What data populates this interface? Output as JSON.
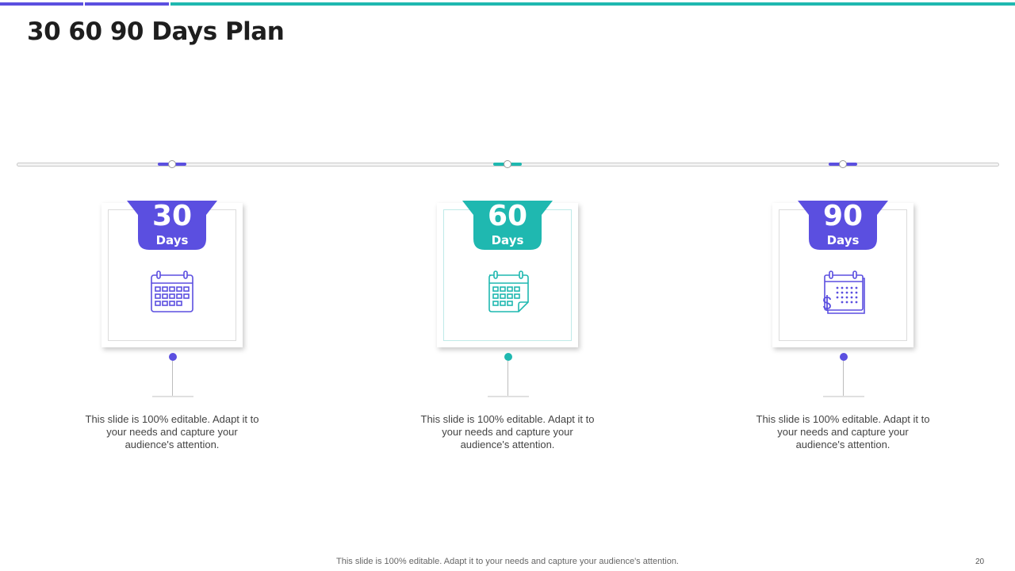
{
  "slide": {
    "title": "30 60 90 Days Plan",
    "footer": "This slide is 100% editable. Adapt it to your needs and capture your audience's attention.",
    "page_number": "20"
  },
  "colors": {
    "purple": "#5b4fe0",
    "teal": "#1fb8b0"
  },
  "phases": [
    {
      "number": "30",
      "unit": "Days",
      "color": "#5b4fe0",
      "icon": "calendar-icon",
      "description": "This slide is 100% editable. Adapt it to your needs and capture your audience's attention."
    },
    {
      "number": "60",
      "unit": "Days",
      "color": "#1fb8b0",
      "icon": "calendar-page-curl-icon",
      "description": "This slide is 100% editable. Adapt it to your needs and capture your audience's attention."
    },
    {
      "number": "90",
      "unit": "Days",
      "color": "#5b4fe0",
      "icon": "calendar-dollar-icon",
      "description": "This slide is 100% editable. Adapt it to your needs and capture your audience's attention."
    }
  ]
}
